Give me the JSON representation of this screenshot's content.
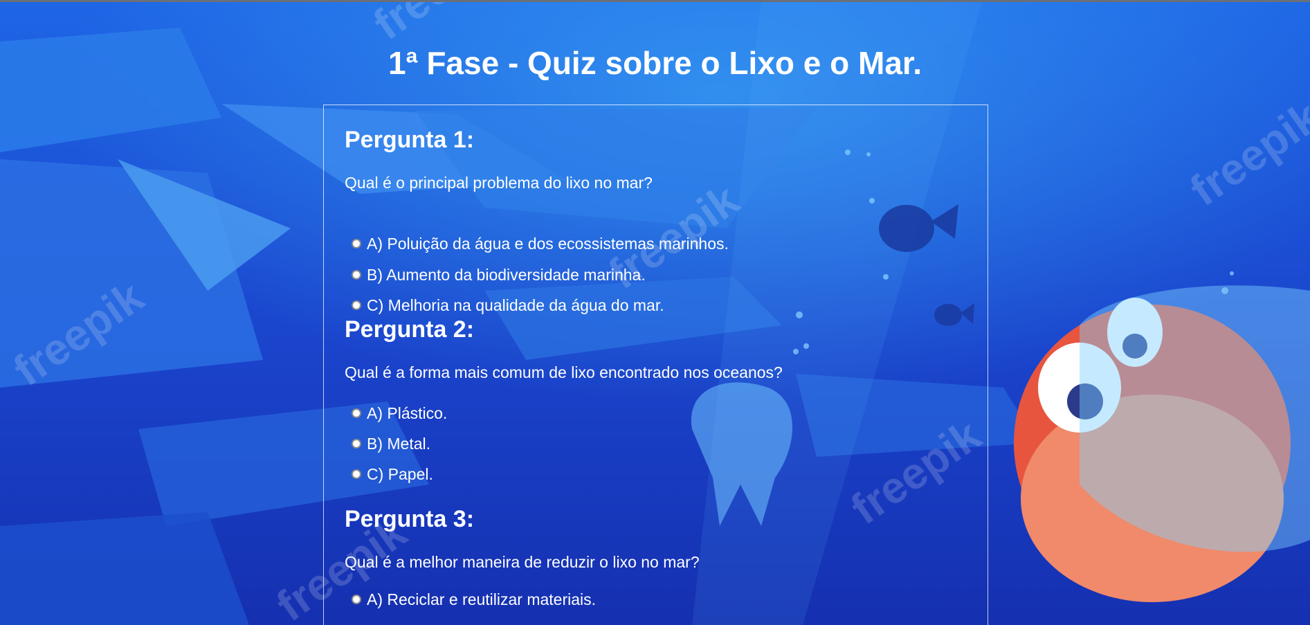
{
  "page": {
    "title": "1ª Fase - Quiz sobre o Lixo e o Mar."
  },
  "background": {
    "watermark": "freepik",
    "colors": {
      "deep": "#1232b8",
      "mid": "#1a55d8",
      "light": "#3a8ff0",
      "ice": "#4fb0f5"
    }
  },
  "questions": [
    {
      "heading": "Pergunta 1:",
      "text": "Qual é o principal problema do lixo no mar?",
      "options": [
        "A) Poluição da água e dos ecossistemas marinhos.",
        "B) Aumento da biodiversidade marinha.",
        "C) Melhoria na qualidade da água do mar."
      ]
    },
    {
      "heading": "Pergunta 2:",
      "text": "Qual é a forma mais comum de lixo encontrado nos oceanos?",
      "options": [
        "A) Plástico.",
        "B) Metal.",
        "C) Papel."
      ]
    },
    {
      "heading": "Pergunta 3:",
      "text": "Qual é a melhor maneira de reduzir o lixo no mar?",
      "options": [
        "A) Reciclar e reutilizar materiais."
      ]
    }
  ]
}
